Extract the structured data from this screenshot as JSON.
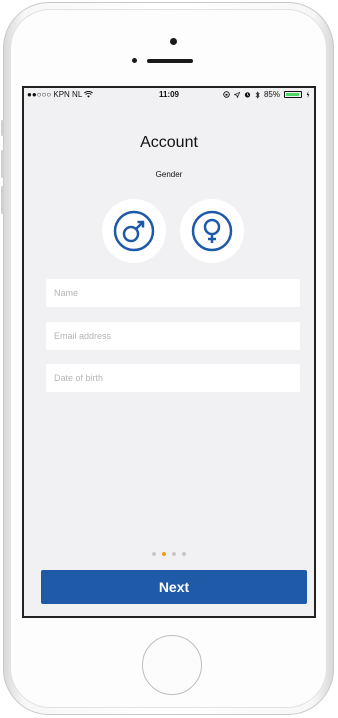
{
  "status_bar": {
    "carrier": "●●○○○ KPN NL",
    "time": "11:09",
    "battery_percent": "85%"
  },
  "screen": {
    "title": "Account",
    "gender_label": "Gender",
    "gender_options": [
      "male-symbol",
      "female-symbol"
    ]
  },
  "form": {
    "name_placeholder": "Name",
    "email_placeholder": "Email address",
    "dob_placeholder": "Date of birth"
  },
  "pager": {
    "total": 4,
    "active_index": 1
  },
  "actions": {
    "next_label": "Next"
  },
  "colors": {
    "accent": "#1e5aa8",
    "pager_active": "#f39c12",
    "background": "#f1f1f3"
  }
}
